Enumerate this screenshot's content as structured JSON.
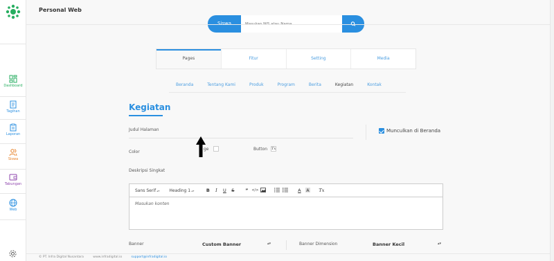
{
  "app": {
    "title": "Personal Web"
  },
  "sidebar": {
    "items": [
      {
        "label": "Dashboard",
        "icon": "dashboard-icon",
        "color": "#27ae60"
      },
      {
        "label": "Tagihan",
        "icon": "invoice-icon",
        "color": "#2a8fe0"
      },
      {
        "label": "Laporan",
        "icon": "clipboard-icon",
        "color": "#2a8fe0"
      },
      {
        "label": "Siswa",
        "icon": "users-icon",
        "color": "#e67e22"
      },
      {
        "label": "Tabungan",
        "icon": "wallet-icon",
        "color": "#8e44ad"
      },
      {
        "label": "Web",
        "icon": "globe-icon",
        "color": "#2a8fe0"
      }
    ]
  },
  "search": {
    "tab_label": "Siswa",
    "placeholder": "Masukan NIS atau Nama",
    "value": ""
  },
  "tabs": [
    {
      "label": "Pages",
      "active": true
    },
    {
      "label": "Fitur",
      "active": false
    },
    {
      "label": "Setting",
      "active": false
    },
    {
      "label": "Media",
      "active": false
    }
  ],
  "subnav": [
    {
      "label": "Beranda",
      "active": false
    },
    {
      "label": "Tentang Kami",
      "active": false
    },
    {
      "label": "Produk",
      "active": false
    },
    {
      "label": "Program",
      "active": false
    },
    {
      "label": "Berita",
      "active": false
    },
    {
      "label": "Kegiatan",
      "active": true
    },
    {
      "label": "Kontak",
      "active": false
    }
  ],
  "section": {
    "title": "Kegiatan"
  },
  "form": {
    "judul_label": "Judul Halaman",
    "show_home_label": "Munculkan di Beranda",
    "show_home_checked": true,
    "color_label": "Color",
    "color_page_partial": "ge",
    "color_button_label": "Button",
    "desc_label": "Deskripsi Singkat"
  },
  "editor": {
    "font": "Sans Serif",
    "heading": "Heading 1",
    "placeholder": "Masukan konten",
    "buttons": [
      "B",
      "I",
      "U",
      "S",
      "”",
      "</>",
      "img",
      "ol",
      "ul",
      "A",
      "bg",
      "Tx"
    ]
  },
  "banner": {
    "label": "Banner",
    "value": "Custom Banner",
    "dimension_label": "Banner Dimension",
    "dimension_value": "Banner Kecil"
  },
  "footer": {
    "copyright": "© PT. Infra Digital Nusantara",
    "website": "www.infradigital.io",
    "email": "support@infradigital.io"
  },
  "colors": {
    "accent": "#2a8fe0"
  }
}
